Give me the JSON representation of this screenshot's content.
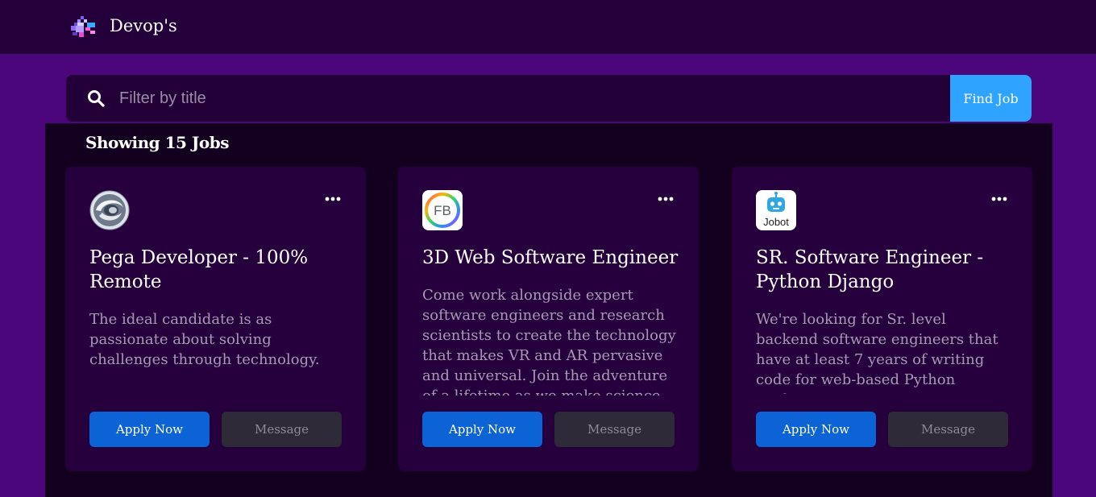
{
  "header": {
    "brand_name": "Devop's",
    "logo_icon": "pixel-art-logo-icon"
  },
  "search": {
    "placeholder": "Filter by title",
    "value": "",
    "button_label": "Find Job",
    "icon": "search-icon"
  },
  "results": {
    "count_label": "Showing 15 Jobs"
  },
  "jobs": [
    {
      "logo_icon": "swirl-sphere-logo-icon",
      "title": "Pega Developer - 100% Remote",
      "description": "The ideal candidate is as passionate about solving challenges through technology.",
      "apply_label": "Apply Now",
      "message_label": "Message"
    },
    {
      "logo_icon": "fb-logo-icon",
      "logo_text": "FB",
      "title": "3D Web Software Engineer",
      "description": "Come work alongside expert software engineers and research scientists to create the technology that makes VR and AR pervasive and universal. Join the adventure of a lifetime as we make science fiction",
      "apply_label": "Apply Now",
      "message_label": "Message"
    },
    {
      "logo_icon": "jobot-robot-logo-icon",
      "logo_text": "Jobot",
      "title": "SR. Software Engineer - Python Django",
      "description": "We're looking for Sr. level backend software engineers that have at least 7 years of writing code for web-based Python applications.",
      "apply_label": "Apply Now",
      "message_label": "Message"
    }
  ],
  "colors": {
    "page_bg": "#4a067a",
    "topbar_bg": "#23003a",
    "panel_bg": "#13001f",
    "card_bg": "#26003d",
    "accent_find": "#2ea3ff",
    "apply_button": "#0b63d6",
    "message_button": "#2e2a38"
  }
}
